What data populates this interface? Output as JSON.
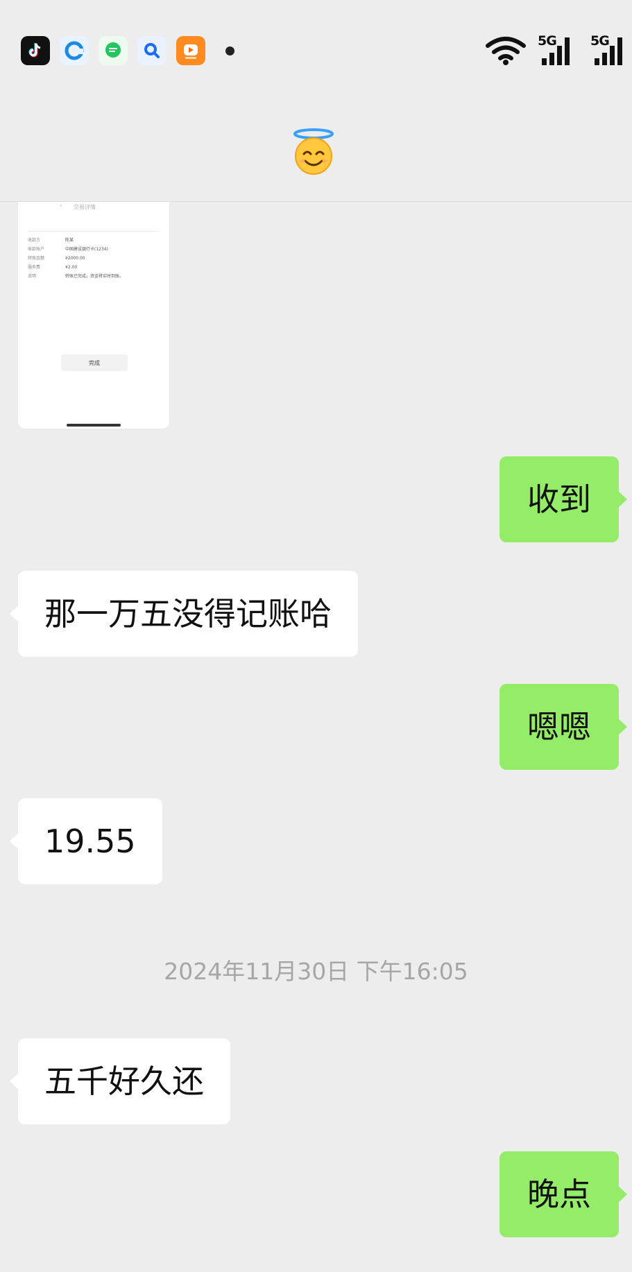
{
  "status_bar": {
    "app_icons": [
      "tiktok-icon",
      "browser-icon",
      "message-app-icon",
      "search-app-icon",
      "video-app-icon"
    ],
    "network_1": "5G",
    "network_2": "5G"
  },
  "chat_header": {
    "contact_emoji": "😇"
  },
  "screenshot_thumbnail": {
    "title": "交易详情",
    "rows": [
      {
        "key": "收款方",
        "value": "陈某"
      },
      {
        "key": "收款账户",
        "value": "中国建设银行卡(1234)"
      },
      {
        "key": "转账金额",
        "value": "¥2000.00"
      },
      {
        "key": "服务费",
        "value": "¥2.00"
      },
      {
        "key": "说明",
        "value": "转账已完成，资金将实时到账。"
      }
    ],
    "done_button": "完成"
  },
  "messages": [
    {
      "direction": "out",
      "text": "收到"
    },
    {
      "direction": "in",
      "text": "那一万五没得记账哈"
    },
    {
      "direction": "out",
      "text": "嗯嗯"
    },
    {
      "direction": "in",
      "text": "19.55"
    },
    {
      "direction": "in",
      "text": "五千好久还"
    },
    {
      "direction": "out",
      "text": "晚点"
    }
  ],
  "timestamp": "2024年11月30日 下午16:05",
  "colors": {
    "background": "#ededed",
    "incoming_bubble": "#ffffff",
    "outgoing_bubble": "#95ec69",
    "timestamp_text": "#a6a6a6"
  }
}
